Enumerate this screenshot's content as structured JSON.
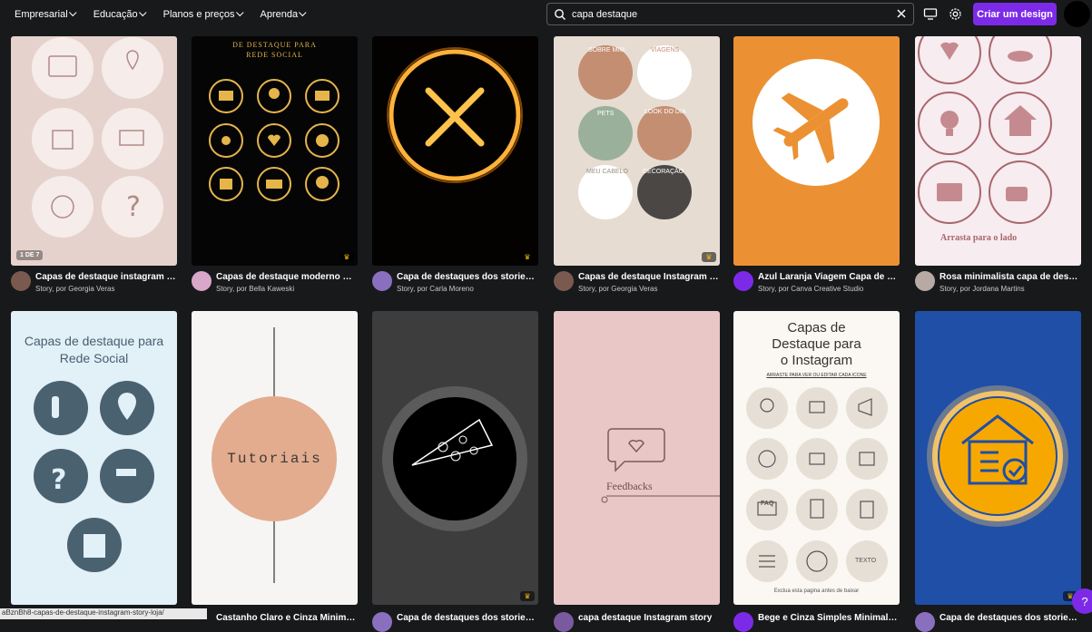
{
  "nav": [
    {
      "label": "Empresarial"
    },
    {
      "label": "Educação"
    },
    {
      "label": "Planos e preços"
    },
    {
      "label": "Aprenda"
    }
  ],
  "search": {
    "value": "capa destaque"
  },
  "cta": {
    "label": "Criar um design"
  },
  "row1": [
    {
      "title": "Capas de destaque instagram st...",
      "sub": "Story, por Georgia Veras",
      "badge": "1 DE 7",
      "premium": false
    },
    {
      "title": "Capas de destaque moderno do...",
      "sub": "Story, por Bella Kaweski",
      "premium": true
    },
    {
      "title": "Capa de destaques dos stories d...",
      "sub": "Story, por Carla Moreno",
      "premium": true
    },
    {
      "title": "Capas de destaque Instagram St...",
      "sub": "Story, por Georgia Veras",
      "premium": true
    },
    {
      "title": "Azul Laranja Viagem Capa de De...",
      "sub": "Story, por Canva Creative Studio",
      "premium": false
    },
    {
      "title": "Rosa minimalista capa de desta...",
      "sub": "Story, por Jordana Martins",
      "premium": false
    }
  ],
  "row2": [
    {
      "title": "",
      "premium": false
    },
    {
      "title": "Castanho Claro e Cinza Minimali...",
      "premium": false
    },
    {
      "title": "Capa de destaques dos stories d...",
      "premium": true
    },
    {
      "title": "capa destaque Instagram story",
      "premium": false
    },
    {
      "title": "Bege e Cinza Simples Minimalist...",
      "premium": false
    },
    {
      "title": "Capa de destaques dos stories d...",
      "premium": true
    }
  ],
  "thumbs": {
    "t2_header": "DE DESTAQUE PARA\nREDE SOCIAL",
    "t4_labels": [
      "SOBRE MIM",
      "VIAGENS",
      "PETS",
      "LOOK DO DIA",
      "MEU CABELO",
      "DECORAÇÃO"
    ],
    "t6_footer": "Arrasta para o lado",
    "r2_1_title": "Capas de destaque para\nRede Social",
    "r2_2_title": "Tutoriais",
    "r2_4_title": "Feedbacks",
    "r2_5_title": "Capas de\nDestaque para\no Instagram",
    "r2_5_sub": "ARRASTE PARA VER OU EDITAR CADA ICONE",
    "r2_5_faq": "FAQ",
    "r2_5_texto": "TEXTO",
    "r2_5_footer": "Exclua esta pagina antes de baixar"
  },
  "status": {
    "url": "aBznBh8-capas-de-destaque-instagram-story-loja/"
  },
  "help": {
    "label": "?"
  },
  "colors": {
    "accent": "#7d2ae8",
    "bg": "#18191b"
  }
}
